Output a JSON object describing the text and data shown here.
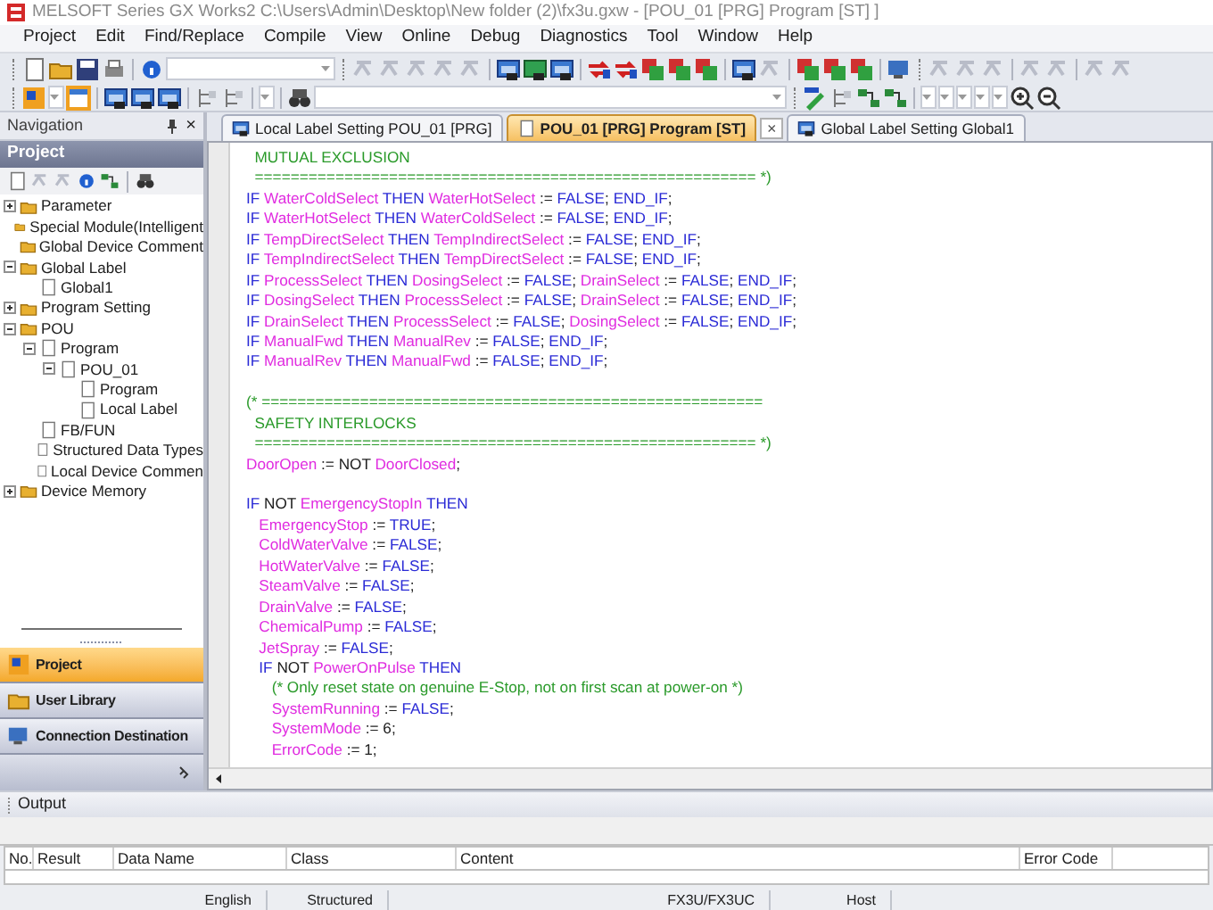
{
  "window": {
    "title": "MELSOFT Series GX Works2 C:\\Users\\Admin\\Desktop\\New folder (2)\\fx3u.gxw - [POU_01 [PRG] Program [ST] ]"
  },
  "menu": [
    "Project",
    "Edit",
    "Find/Replace",
    "Compile",
    "View",
    "Online",
    "Debug",
    "Diagnostics",
    "Tool",
    "Window",
    "Help"
  ],
  "navigation": {
    "title": "Navigation",
    "close": "×"
  },
  "project_panel": {
    "title": "Project",
    "tree": [
      {
        "label": "Parameter",
        "expanded": false
      },
      {
        "label": "Special Module(Intelligent"
      },
      {
        "label": "Global Device Comment"
      },
      {
        "label": "Global Label",
        "expanded": true,
        "children": [
          {
            "label": "Global1"
          }
        ]
      },
      {
        "label": "Program Setting",
        "expanded": false
      },
      {
        "label": "POU",
        "expanded": true,
        "children": [
          {
            "label": "Program",
            "expanded": true,
            "children": [
              {
                "label": "POU_01",
                "expanded": true,
                "children": [
                  {
                    "label": "Program"
                  },
                  {
                    "label": "Local Label"
                  }
                ]
              }
            ]
          },
          {
            "label": "FB/FUN"
          },
          {
            "label": "Structured Data Types"
          },
          {
            "label": "Local Device Commen"
          }
        ]
      },
      {
        "label": "Device Memory",
        "expanded": false
      }
    ]
  },
  "nav_buttons": [
    {
      "label": "Project",
      "selected": true
    },
    {
      "label": "User Library",
      "selected": false
    },
    {
      "label": "Connection Destination",
      "selected": false
    }
  ],
  "tabs": [
    {
      "label": "Local Label Setting POU_01 [PRG]",
      "selected": false
    },
    {
      "label": "POU_01 [PRG] Program [ST]",
      "selected": true,
      "close": "×"
    },
    {
      "label": "Global Label Setting Global1",
      "selected": false
    }
  ],
  "code_blocks": [
    [
      [
        {
          "kind": "comment",
          "text": "  MUTUAL EXCLUSION"
        }
      ],
      [
        {
          "kind": "comment",
          "text": "  ======================================================== *)"
        }
      ],
      [
        {
          "kind": "keyword",
          "text": "IF "
        },
        {
          "kind": "variable",
          "text": "WaterColdSelect"
        },
        {
          "kind": "keyword",
          "text": " THEN "
        },
        {
          "kind": "variable",
          "text": "WaterHotSelect"
        },
        {
          "kind": "operator",
          "text": " := "
        },
        {
          "kind": "keyword",
          "text": "FALSE"
        },
        {
          "kind": "operator",
          "text": "; "
        },
        {
          "kind": "keyword",
          "text": "END_IF"
        },
        {
          "kind": "operator",
          "text": ";"
        }
      ],
      [
        {
          "kind": "keyword",
          "text": "IF "
        },
        {
          "kind": "variable",
          "text": "WaterHotSelect"
        },
        {
          "kind": "keyword",
          "text": " THEN "
        },
        {
          "kind": "variable",
          "text": "WaterColdSelect"
        },
        {
          "kind": "operator",
          "text": " := "
        },
        {
          "kind": "keyword",
          "text": "FALSE"
        },
        {
          "kind": "operator",
          "text": "; "
        },
        {
          "kind": "keyword",
          "text": "END_IF"
        },
        {
          "kind": "operator",
          "text": ";"
        }
      ],
      [
        {
          "kind": "keyword",
          "text": "IF "
        },
        {
          "kind": "variable",
          "text": "TempDirectSelect"
        },
        {
          "kind": "keyword",
          "text": " THEN "
        },
        {
          "kind": "variable",
          "text": "TempIndirectSelect"
        },
        {
          "kind": "operator",
          "text": " := "
        },
        {
          "kind": "keyword",
          "text": "FALSE"
        },
        {
          "kind": "operator",
          "text": "; "
        },
        {
          "kind": "keyword",
          "text": "END_IF"
        },
        {
          "kind": "operator",
          "text": ";"
        }
      ],
      [
        {
          "kind": "keyword",
          "text": "IF "
        },
        {
          "kind": "variable",
          "text": "TempIndirectSelect"
        },
        {
          "kind": "keyword",
          "text": " THEN "
        },
        {
          "kind": "variable",
          "text": "TempDirectSelect"
        },
        {
          "kind": "operator",
          "text": " := "
        },
        {
          "kind": "keyword",
          "text": "FALSE"
        },
        {
          "kind": "operator",
          "text": "; "
        },
        {
          "kind": "keyword",
          "text": "END_IF"
        },
        {
          "kind": "operator",
          "text": ";"
        }
      ],
      [
        {
          "kind": "keyword",
          "text": "IF "
        },
        {
          "kind": "variable",
          "text": "ProcessSelect"
        },
        {
          "kind": "keyword",
          "text": " THEN "
        },
        {
          "kind": "variable",
          "text": "DosingSelect"
        },
        {
          "kind": "operator",
          "text": " := "
        },
        {
          "kind": "keyword",
          "text": "FALSE"
        },
        {
          "kind": "operator",
          "text": "; "
        },
        {
          "kind": "variable",
          "text": "DrainSelect"
        },
        {
          "kind": "operator",
          "text": " := "
        },
        {
          "kind": "keyword",
          "text": "FALSE"
        },
        {
          "kind": "operator",
          "text": "; "
        },
        {
          "kind": "keyword",
          "text": "END_IF"
        },
        {
          "kind": "operator",
          "text": ";"
        }
      ],
      [
        {
          "kind": "keyword",
          "text": "IF "
        },
        {
          "kind": "variable",
          "text": "DosingSelect"
        },
        {
          "kind": "keyword",
          "text": " THEN "
        },
        {
          "kind": "variable",
          "text": "ProcessSelect"
        },
        {
          "kind": "operator",
          "text": " := "
        },
        {
          "kind": "keyword",
          "text": "FALSE"
        },
        {
          "kind": "operator",
          "text": "; "
        },
        {
          "kind": "variable",
          "text": "DrainSelect"
        },
        {
          "kind": "operator",
          "text": " := "
        },
        {
          "kind": "keyword",
          "text": "FALSE"
        },
        {
          "kind": "operator",
          "text": "; "
        },
        {
          "kind": "keyword",
          "text": "END_IF"
        },
        {
          "kind": "operator",
          "text": ";"
        }
      ],
      [
        {
          "kind": "keyword",
          "text": "IF "
        },
        {
          "kind": "variable",
          "text": "DrainSelect"
        },
        {
          "kind": "keyword",
          "text": " THEN "
        },
        {
          "kind": "variable",
          "text": "ProcessSelect"
        },
        {
          "kind": "operator",
          "text": " := "
        },
        {
          "kind": "keyword",
          "text": "FALSE"
        },
        {
          "kind": "operator",
          "text": "; "
        },
        {
          "kind": "variable",
          "text": "DosingSelect"
        },
        {
          "kind": "operator",
          "text": " := "
        },
        {
          "kind": "keyword",
          "text": "FALSE"
        },
        {
          "kind": "operator",
          "text": "; "
        },
        {
          "kind": "keyword",
          "text": "END_IF"
        },
        {
          "kind": "operator",
          "text": ";"
        }
      ],
      [
        {
          "kind": "keyword",
          "text": "IF "
        },
        {
          "kind": "variable",
          "text": "ManualFwd"
        },
        {
          "kind": "keyword",
          "text": " THEN "
        },
        {
          "kind": "variable",
          "text": "ManualRev"
        },
        {
          "kind": "operator",
          "text": " := "
        },
        {
          "kind": "keyword",
          "text": "FALSE"
        },
        {
          "kind": "operator",
          "text": "; "
        },
        {
          "kind": "keyword",
          "text": "END_IF"
        },
        {
          "kind": "operator",
          "text": ";"
        }
      ],
      [
        {
          "kind": "keyword",
          "text": "IF "
        },
        {
          "kind": "variable",
          "text": "ManualRev"
        },
        {
          "kind": "keyword",
          "text": " THEN "
        },
        {
          "kind": "variable",
          "text": "ManualFwd"
        },
        {
          "kind": "operator",
          "text": " := "
        },
        {
          "kind": "keyword",
          "text": "FALSE"
        },
        {
          "kind": "operator",
          "text": "; "
        },
        {
          "kind": "keyword",
          "text": "END_IF"
        },
        {
          "kind": "operator",
          "text": ";"
        }
      ]
    ],
    [
      [
        {
          "kind": "comment",
          "text": "(* ========================================================"
        }
      ],
      [
        {
          "kind": "comment",
          "text": "  SAFETY INTERLOCKS"
        }
      ],
      [
        {
          "kind": "comment",
          "text": "  ======================================================== *)"
        }
      ],
      [
        {
          "kind": "variable",
          "text": "DoorOpen"
        },
        {
          "kind": "operator",
          "text": " := NOT "
        },
        {
          "kind": "variable",
          "text": "DoorClosed"
        },
        {
          "kind": "operator",
          "text": ";"
        }
      ]
    ],
    [
      [
        {
          "kind": "keyword",
          "text": "IF "
        },
        {
          "kind": "operator",
          "text": "NOT "
        },
        {
          "kind": "variable",
          "text": "EmergencyStopIn"
        },
        {
          "kind": "keyword",
          "text": " THEN"
        }
      ],
      [
        {
          "kind": "variable",
          "text": "   EmergencyStop"
        },
        {
          "kind": "operator",
          "text": " := "
        },
        {
          "kind": "keyword",
          "text": "TRUE"
        },
        {
          "kind": "operator",
          "text": ";"
        }
      ],
      [
        {
          "kind": "variable",
          "text": "   ColdWaterValve"
        },
        {
          "kind": "operator",
          "text": " := "
        },
        {
          "kind": "keyword",
          "text": "FALSE"
        },
        {
          "kind": "operator",
          "text": ";"
        }
      ],
      [
        {
          "kind": "variable",
          "text": "   HotWaterValve"
        },
        {
          "kind": "operator",
          "text": " := "
        },
        {
          "kind": "keyword",
          "text": "FALSE"
        },
        {
          "kind": "operator",
          "text": ";"
        }
      ],
      [
        {
          "kind": "variable",
          "text": "   SteamValve"
        },
        {
          "kind": "operator",
          "text": " := "
        },
        {
          "kind": "keyword",
          "text": "FALSE"
        },
        {
          "kind": "operator",
          "text": ";"
        }
      ],
      [
        {
          "kind": "variable",
          "text": "   DrainValve"
        },
        {
          "kind": "operator",
          "text": " := "
        },
        {
          "kind": "keyword",
          "text": "FALSE"
        },
        {
          "kind": "operator",
          "text": ";"
        }
      ],
      [
        {
          "kind": "variable",
          "text": "   ChemicalPump"
        },
        {
          "kind": "operator",
          "text": " := "
        },
        {
          "kind": "keyword",
          "text": "FALSE"
        },
        {
          "kind": "operator",
          "text": ";"
        }
      ],
      [
        {
          "kind": "variable",
          "text": "   JetSpray"
        },
        {
          "kind": "operator",
          "text": " := "
        },
        {
          "kind": "keyword",
          "text": "FALSE"
        },
        {
          "kind": "operator",
          "text": ";"
        }
      ],
      [
        {
          "kind": "keyword",
          "text": "   IF "
        },
        {
          "kind": "operator",
          "text": "NOT "
        },
        {
          "kind": "variable",
          "text": "PowerOnPulse"
        },
        {
          "kind": "keyword",
          "text": " THEN"
        }
      ],
      [
        {
          "kind": "comment",
          "text": "      (* Only reset state on genuine E-Stop, not on first scan at power-on *)"
        }
      ],
      [
        {
          "kind": "variable",
          "text": "      SystemRunning"
        },
        {
          "kind": "operator",
          "text": " := "
        },
        {
          "kind": "keyword",
          "text": "FALSE"
        },
        {
          "kind": "operator",
          "text": ";"
        }
      ],
      [
        {
          "kind": "variable",
          "text": "      SystemMode"
        },
        {
          "kind": "operator",
          "text": " := 6;"
        }
      ],
      [
        {
          "kind": "variable",
          "text": "      ErrorCode"
        },
        {
          "kind": "operator",
          "text": " := 1;"
        }
      ]
    ]
  ],
  "output": {
    "title": "Output",
    "columns": [
      "No.",
      "Result",
      "Data Name",
      "Class",
      "Content",
      "Error Code"
    ]
  },
  "status_bar": [
    "English",
    "Structured",
    "FX3U/FX3UC",
    "Host"
  ]
}
